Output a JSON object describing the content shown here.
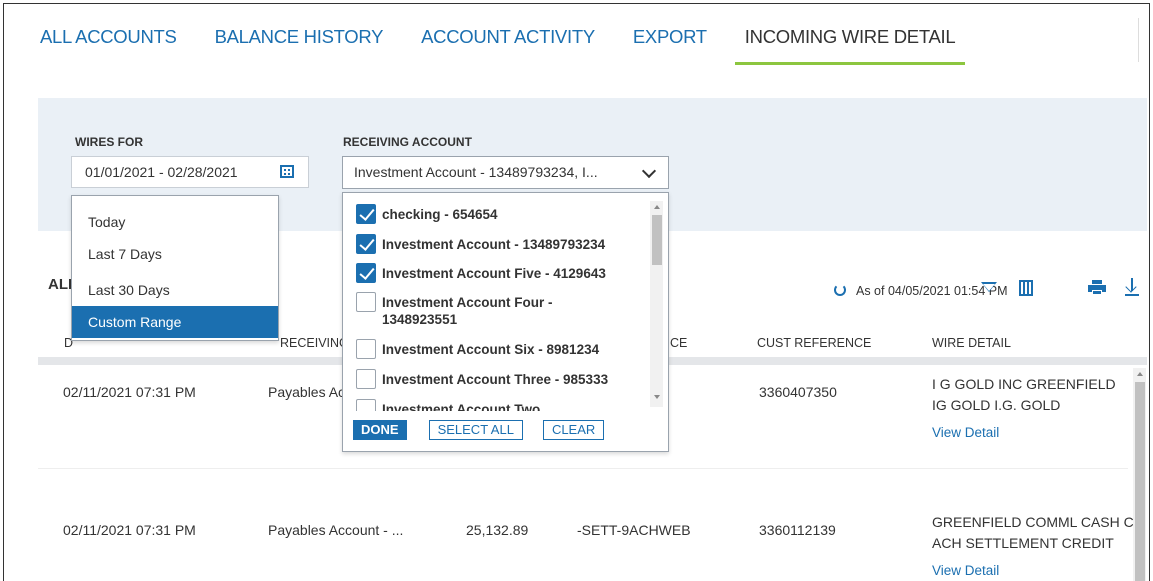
{
  "tabs": [
    {
      "label": "ALL ACCOUNTS",
      "active": false
    },
    {
      "label": "BALANCE HISTORY",
      "active": false
    },
    {
      "label": "ACCOUNT ACTIVITY",
      "active": false
    },
    {
      "label": "EXPORT",
      "active": false
    },
    {
      "label": "INCOMING WIRE DETAIL",
      "active": true
    }
  ],
  "filters": {
    "wires_for_label": "WIRES FOR",
    "wires_for_value": "01/01/2021 - 02/28/2021",
    "receiving_account_label": "RECEIVING ACCOUNT",
    "receiving_account_value": "Investment Account - 13489793234, I..."
  },
  "date_menu": {
    "options": [
      "Today",
      "Last 7 Days",
      "Last 30 Days",
      "Custom Range"
    ],
    "selected": "Custom Range"
  },
  "account_menu": {
    "items": [
      {
        "label": "checking - 654654",
        "checked": true
      },
      {
        "label": "Investment Account - 13489793234",
        "checked": true
      },
      {
        "label": "Investment Account Five - 4129643",
        "checked": true
      },
      {
        "label": "Investment Account Four - 1348923551",
        "checked": false
      },
      {
        "label": "Investment Account Six - 8981234",
        "checked": false
      },
      {
        "label": "Investment Account Three - 985333",
        "checked": false
      },
      {
        "label": "Investment Account Two",
        "checked": false
      }
    ],
    "done_label": "DONE",
    "select_all_label": "SELECT ALL",
    "clear_label": "CLEAR"
  },
  "toolbar": {
    "section_title": "ALL",
    "as_of": "As of 04/05/2021 01:54 PM"
  },
  "table": {
    "headers": {
      "date": "D",
      "receiving_account": "RECEIVING AC",
      "reference": "CE",
      "cust_reference": "CUST REFERENCE",
      "wire_detail": "WIRE DETAIL"
    },
    "rows": [
      {
        "date": "02/11/2021 07:31 PM",
        "account": "Payables Ac",
        "amount": "",
        "reference": "",
        "cust_reference": "3360407350",
        "wire_line1": "I G GOLD INC GREENFIELD",
        "wire_line2": "IG GOLD I.G. GOLD",
        "link": "View Detail"
      },
      {
        "date": "02/11/2021 07:31 PM",
        "account": "Payables Account - ...",
        "amount": "25,132.89",
        "reference": "-SETT-9ACHWEB",
        "cust_reference": "3360112139",
        "wire_line1": "GREENFIELD COMML CASH C&",
        "wire_line2": "ACH SETTLEMENT CREDIT",
        "link": "View Detail"
      }
    ]
  },
  "colors": {
    "accent": "#1b6fb0",
    "tab_underline": "#8cc63f",
    "filter_bg": "#eaf0f6"
  }
}
